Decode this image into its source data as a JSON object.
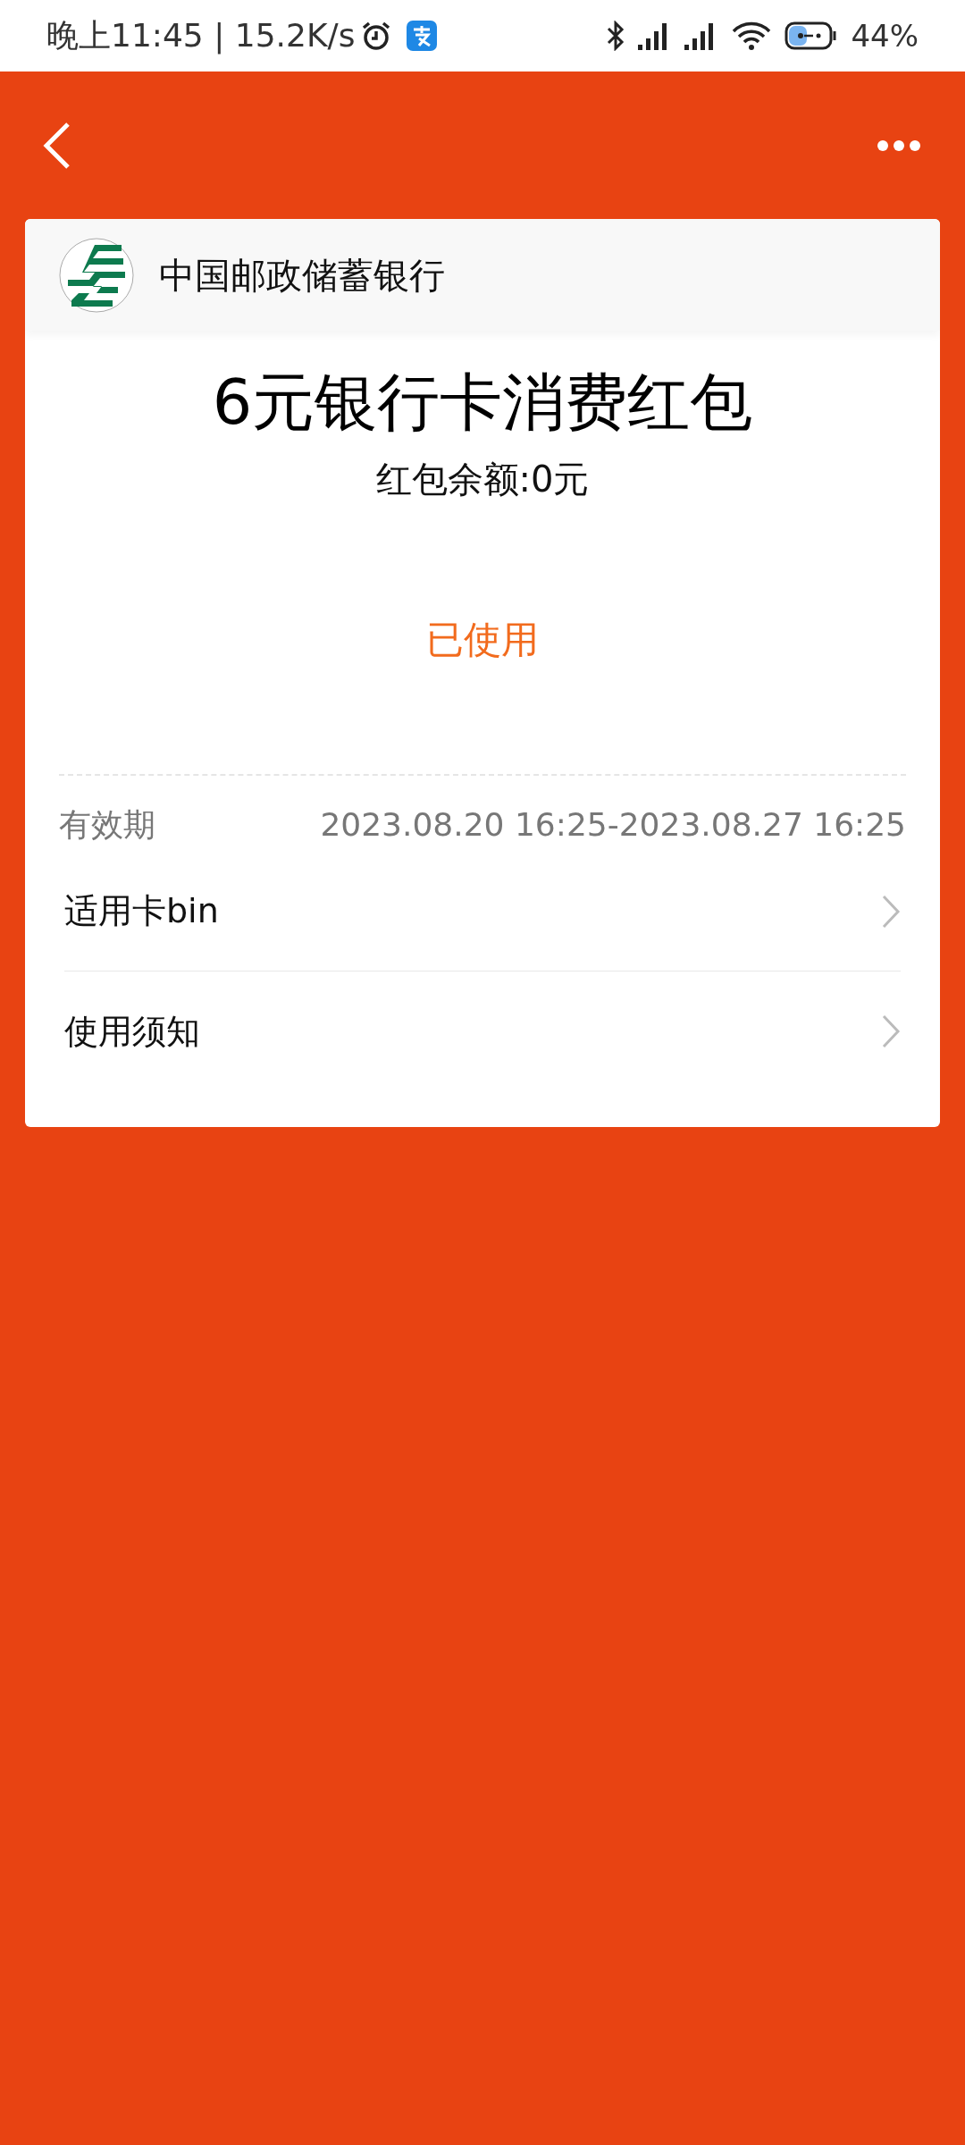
{
  "status_bar": {
    "time_speed": "晚上11:45 | 15.2K/s",
    "battery": "44%"
  },
  "bank": {
    "name": "中国邮政储蓄银行"
  },
  "coupon": {
    "title": "6元银行卡消费红包",
    "balance": "红包余额:0元",
    "status": "已使用"
  },
  "validity": {
    "label": "有效期",
    "value": "2023.08.20 16:25-2023.08.27 16:25"
  },
  "links": [
    {
      "label": "适用卡bin"
    },
    {
      "label": "使用须知"
    }
  ]
}
